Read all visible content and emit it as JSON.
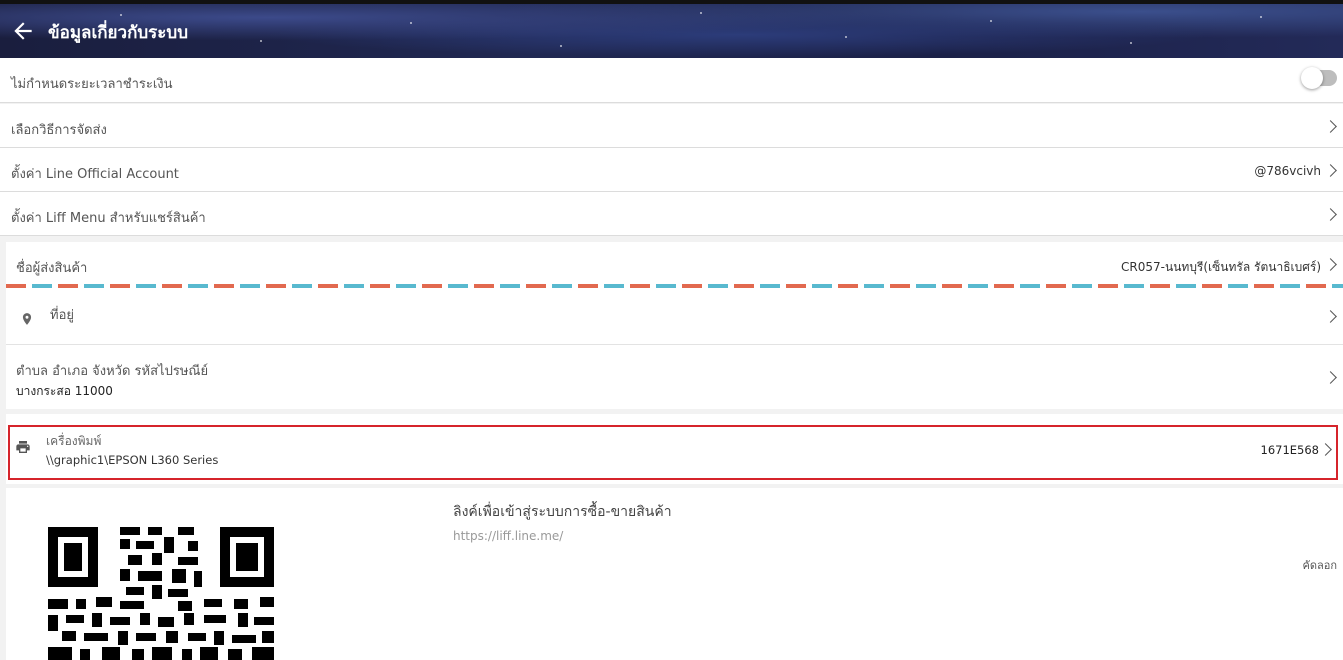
{
  "header": {
    "title": "ข้อมูลเกี่ยวกับระบบ",
    "back_icon": "arrow-left-icon"
  },
  "settings": {
    "no_payment_limit_label": "ไม่กำหนดระยะเวลาชำระเงิน",
    "no_payment_limit_enabled": false,
    "shipping_method_label": "เลือกวิธีการจัดส่ง",
    "line_oa_label": "ตั้งค่า Line Official Account",
    "line_oa_value": "@786vcivh",
    "liff_menu_label": "ตั้งค่า Liff Menu สำหรับแชร์สินค้า"
  },
  "sender": {
    "label": "ชื่อผู้ส่งสินค้า",
    "value": "CR057-นนทบุรี(เซ็นทรัล รัตนาธิเบศร์)",
    "address_label": "ที่อยู่",
    "district_label": "ตำบล อำเภอ จังหวัด รหัสไปรษณีย์",
    "district_value": "บางกระสอ 11000"
  },
  "printer": {
    "label": "เครื่องพิมพ์",
    "path": "\\\\graphic1\\EPSON L360 Series",
    "code": "1671E568"
  },
  "liff": {
    "title": "ลิงค์เพื่อเข้าสู่ระบบการซื้อ-ขายสินค้า",
    "url": "https://liff.line.me/",
    "copy_label": "คัดลอก"
  },
  "colors": {
    "accent_red": "#d6242b",
    "stripe_red": "#e2694f",
    "stripe_blue": "#58b9cf"
  }
}
